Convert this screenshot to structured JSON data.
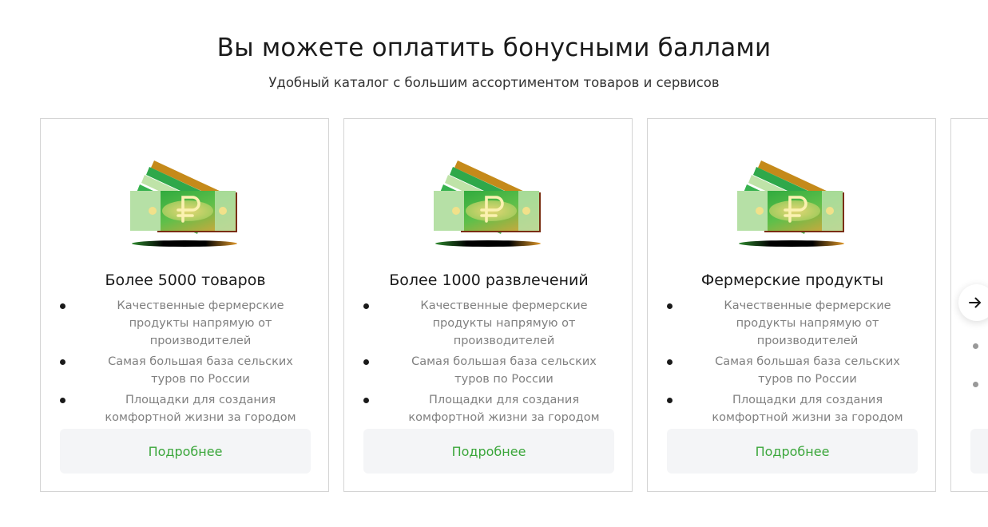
{
  "header": {
    "title": "Вы можете оплатить бонусными баллами",
    "subtitle": "Удобный каталог с большим ассортиментом товаров и сервисов"
  },
  "cards": [
    {
      "title": "Более 5000 товаров",
      "image_icon": "ruble-banknotes-icon",
      "features": [
        "Качественные фермерские продукты напрямую от производителей",
        "Самая большая база сельских туров по России",
        "Площадки для создания комфортной жизни за городом"
      ],
      "button_label": "Подробнее"
    },
    {
      "title": "Более 1000 развлечений",
      "image_icon": "ruble-banknotes-icon",
      "features": [
        "Качественные фермерские продукты напрямую от производителей",
        "Самая большая база сельских туров по России",
        "Площадки для создания комфортной жизни за городом"
      ],
      "button_label": "Подробнее"
    },
    {
      "title": "Фермерские продукты",
      "image_icon": "ruble-banknotes-icon",
      "features": [
        "Качественные фермерские продукты напрямую от производителей",
        "Самая большая база сельских туров по России",
        "Площадки для создания комфортной жизни за городом"
      ],
      "button_label": "Подробнее"
    }
  ],
  "carousel": {
    "next_icon": "arrow-right-icon"
  },
  "colors": {
    "accent": "#3aa63a",
    "button_bg": "#f4f5f7",
    "card_border": "#d4d4d4",
    "muted_text": "#808080"
  }
}
